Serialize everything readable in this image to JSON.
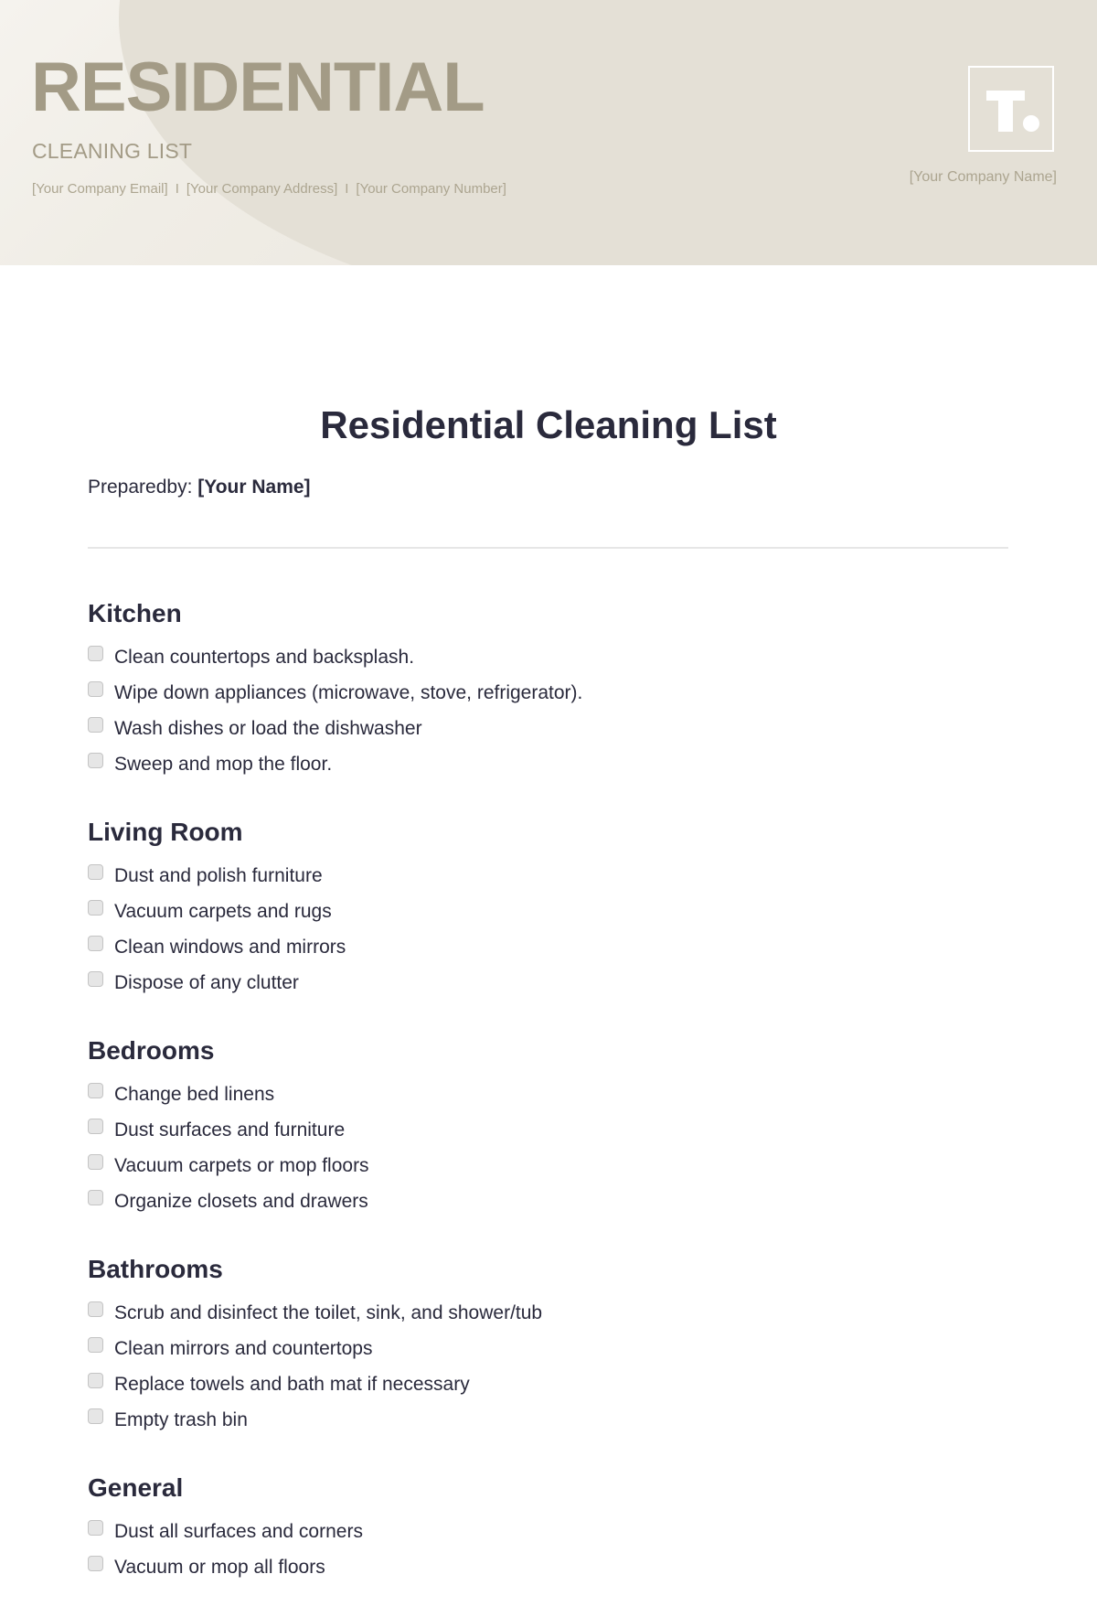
{
  "header": {
    "title": "RESIDENTIAL",
    "subtitle": "CLEANING LIST",
    "contact": {
      "email": "[Your Company Email]",
      "address": "[Your Company Address]",
      "number": "[Your Company Number]",
      "separator": "I"
    },
    "logo_icon": "T.",
    "company_name": "[Your Company Name]"
  },
  "document": {
    "title": "Residential Cleaning List",
    "prepared_by_label": "Preparedby:",
    "prepared_by_value": "[Your Name]"
  },
  "sections": [
    {
      "heading": "Kitchen",
      "items": [
        {
          "label": "Clean countertops and backsplash.",
          "checked": false
        },
        {
          "label": "Wipe down appliances (microwave, stove, refrigerator).",
          "checked": false
        },
        {
          "label": "Wash dishes or load the dishwasher",
          "checked": false
        },
        {
          "label": "Sweep and mop the floor.",
          "checked": false
        }
      ]
    },
    {
      "heading": "Living Room",
      "items": [
        {
          "label": "Dust and polish furniture",
          "checked": false
        },
        {
          "label": "Vacuum carpets and rugs",
          "checked": false
        },
        {
          "label": "Clean windows and mirrors",
          "checked": false
        },
        {
          "label": "Dispose of any clutter",
          "checked": false
        }
      ]
    },
    {
      "heading": "Bedrooms",
      "items": [
        {
          "label": "Change bed linens",
          "checked": false
        },
        {
          "label": "Dust surfaces and furniture",
          "checked": false
        },
        {
          "label": "Vacuum carpets or mop floors",
          "checked": false
        },
        {
          "label": "Organize closets and drawers",
          "checked": false
        }
      ]
    },
    {
      "heading": "Bathrooms",
      "items": [
        {
          "label": "Scrub and disinfect the toilet, sink, and shower/tub",
          "checked": false
        },
        {
          "label": "Clean mirrors and countertops",
          "checked": false
        },
        {
          "label": "Replace towels and bath mat if necessary",
          "checked": false
        },
        {
          "label": "Empty trash bin",
          "checked": false
        }
      ]
    },
    {
      "heading": "General",
      "items": [
        {
          "label": "Dust all surfaces and corners",
          "checked": false
        },
        {
          "label": "Vacuum or mop all floors",
          "checked": false
        }
      ]
    }
  ],
  "colors": {
    "header_bg": "#e4e0d6",
    "brand_accent": "#a39b86",
    "text_dark": "#2a2a3c"
  }
}
